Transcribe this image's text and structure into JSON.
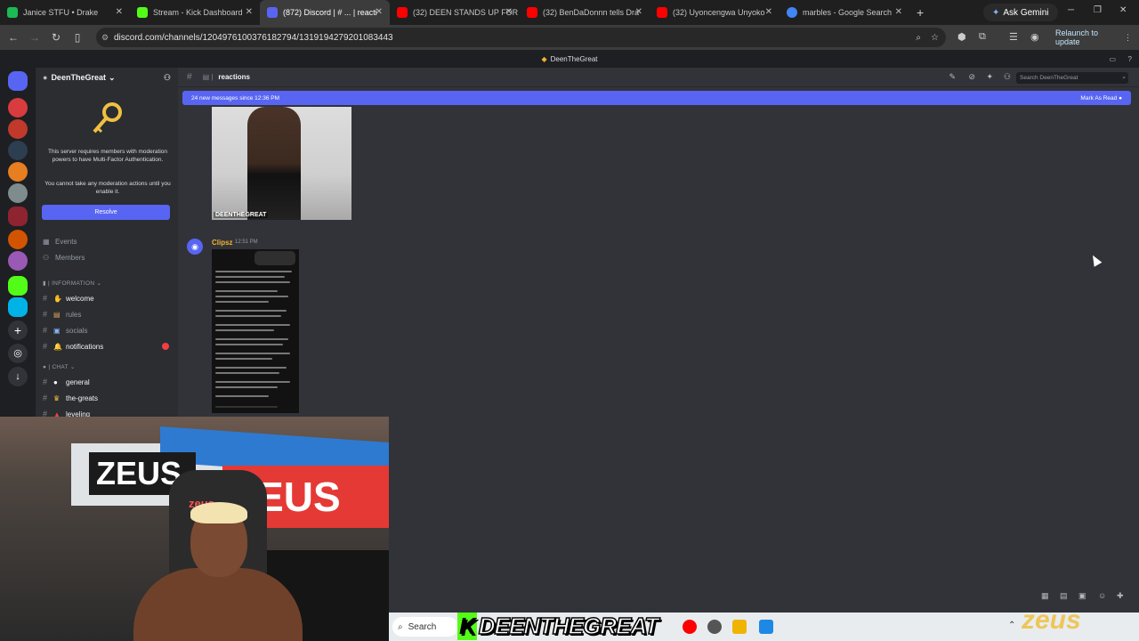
{
  "browser": {
    "tabs": [
      {
        "title": "Janice STFU • Drake",
        "color": "#1db954"
      },
      {
        "title": "Stream - Kick Dashboard",
        "color": "#53fc18"
      },
      {
        "title": "(872) Discord | # ... | reacti",
        "color": "#5865f2"
      },
      {
        "title": "(32) DEEN STANDS UP FOR",
        "color": "#ff0000"
      },
      {
        "title": "(32) BenDaDonnn tells Dra",
        "color": "#ff0000"
      },
      {
        "title": "(32) Uyoncengwa Unyoko",
        "color": "#ff0000"
      },
      {
        "title": "marbles - Google Search",
        "color": "#4285f4"
      }
    ],
    "new_tab": "+",
    "gemini_label": "Ask Gemini",
    "url": "discord.com/channels/1204976100376182794/1319194279201083443",
    "relaunch_label": "Relaunch to update"
  },
  "discord": {
    "window_title": "DeenTheGreat",
    "server_name": "DeenTheGreat",
    "mfa_notice": "This server requires members with moderation powers to have Multi-Factor Authentication.",
    "mfa_notice2": "You cannot take any moderation actions until you enable it.",
    "resolve_label": "Resolve",
    "events_label": "Events",
    "members_label": "Members",
    "cat_information": "INFORMATION",
    "cat_chat": "CHAT",
    "channels_info": [
      "welcome",
      "rules",
      "socials",
      "notifications"
    ],
    "channels_chat": [
      "general",
      "the-greats",
      "leveling"
    ],
    "channel_name": "reactions",
    "search_placeholder": "Search DeenTheGreat",
    "new_messages": "24 new messages since 12:36 PM",
    "mark_as_read": "Mark As Read",
    "image_watermark": "DEENTHEGREAT",
    "message_author": "Clipsz",
    "message_time": "12:51 PM"
  },
  "taskbar": {
    "search_label": "Search"
  },
  "overlay": {
    "stream_name": "DEENTHEGREAT",
    "brand": "zeus",
    "banner_text": "ZEUS",
    "chair_logo": "zeus"
  },
  "colors": {
    "discord_bg": "#313338",
    "blurple": "#5865f2",
    "kick_green": "#53fc18"
  }
}
